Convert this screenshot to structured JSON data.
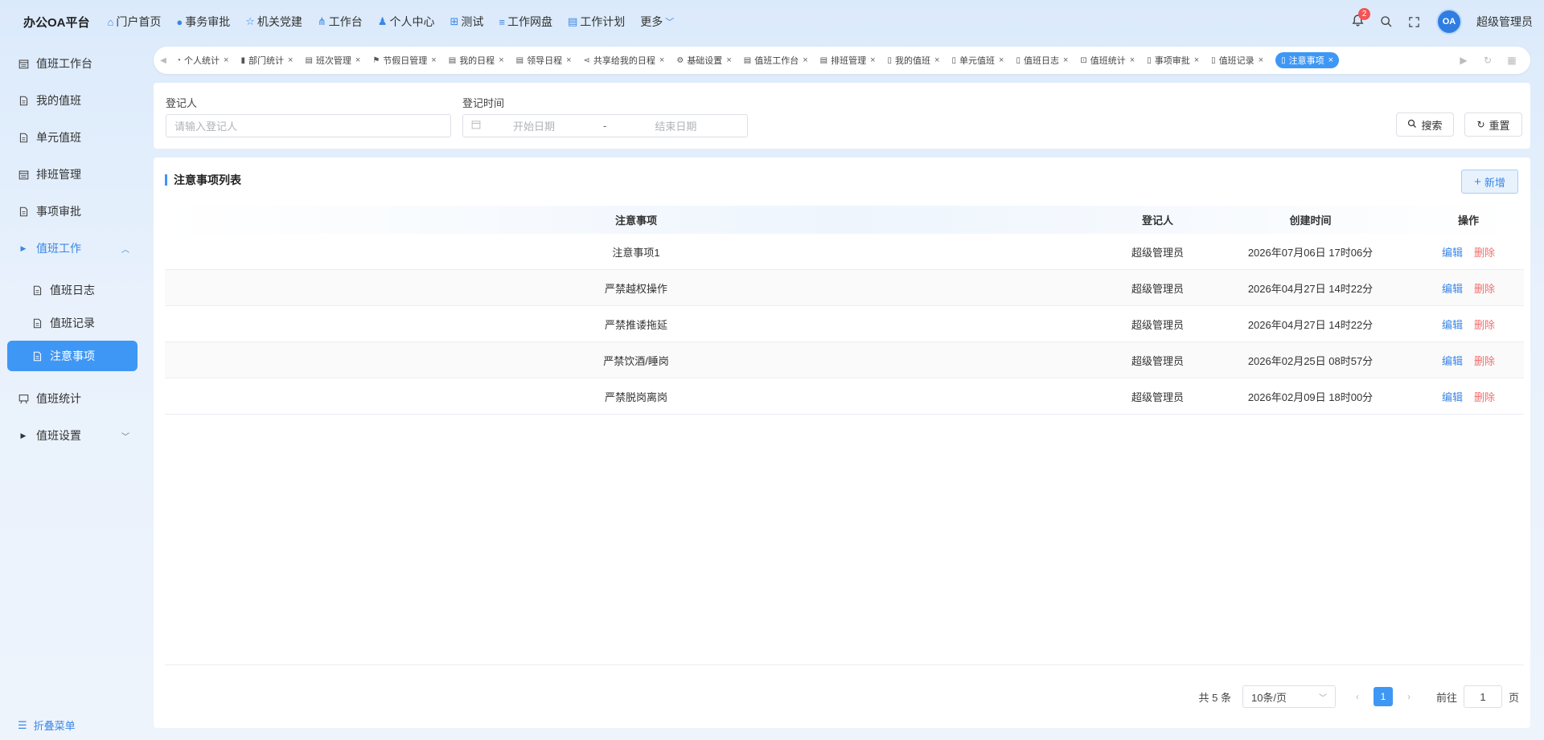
{
  "app": {
    "title": "办公OA平台"
  },
  "nav": [
    {
      "icon": "home-icon",
      "glyph": "⌂",
      "label": "门户首页"
    },
    {
      "icon": "approval-icon",
      "glyph": "●",
      "label": "事务审批"
    },
    {
      "icon": "star-icon",
      "glyph": "☆",
      "label": "机关党建"
    },
    {
      "icon": "workbench-icon",
      "glyph": "⋔",
      "label": "工作台"
    },
    {
      "icon": "user-icon",
      "glyph": "♟",
      "label": "个人中心"
    },
    {
      "icon": "grid-icon",
      "glyph": "⊞",
      "label": "测试"
    },
    {
      "icon": "database-icon",
      "glyph": "≡",
      "label": "工作网盘"
    },
    {
      "icon": "calendar-icon",
      "glyph": "▤",
      "label": "工作计划"
    }
  ],
  "nav_more": "更多",
  "header": {
    "badge_count": "2",
    "avatar_text": "OA",
    "username": "超级管理员"
  },
  "sidebar": {
    "items": [
      {
        "label": "值班工作台",
        "icon": "calendar-icon"
      },
      {
        "label": "我的值班",
        "icon": "document-icon"
      },
      {
        "label": "单元值班",
        "icon": "document-icon"
      },
      {
        "label": "排班管理",
        "icon": "calendar-icon"
      },
      {
        "label": "事项审批",
        "icon": "document-icon"
      },
      {
        "label": "值班工作",
        "icon": "caret-right-icon"
      },
      {
        "label": "值班日志",
        "icon": "document-icon"
      },
      {
        "label": "值班记录",
        "icon": "document-icon"
      },
      {
        "label": "注意事项",
        "icon": "document-icon"
      },
      {
        "label": "值班统计",
        "icon": "board-icon"
      },
      {
        "label": "值班设置",
        "icon": "caret-right-icon"
      }
    ],
    "collapse_label": "折叠菜单"
  },
  "tabs": [
    {
      "label": "个人统计",
      "icon": "pie-icon"
    },
    {
      "label": "部门统计",
      "icon": "bar-icon"
    },
    {
      "label": "班次管理",
      "icon": "calendar-icon"
    },
    {
      "label": "节假日管理",
      "icon": "flag-icon"
    },
    {
      "label": "我的日程",
      "icon": "calendar-icon"
    },
    {
      "label": "领导日程",
      "icon": "calendar-icon"
    },
    {
      "label": "共享给我的日程",
      "icon": "share-icon"
    },
    {
      "label": "基础设置",
      "icon": "gear-icon"
    },
    {
      "label": "值班工作台",
      "icon": "calendar-icon"
    },
    {
      "label": "排班管理",
      "icon": "calendar-icon"
    },
    {
      "label": "我的值班",
      "icon": "document-icon"
    },
    {
      "label": "单元值班",
      "icon": "document-icon"
    },
    {
      "label": "值班日志",
      "icon": "document-icon"
    },
    {
      "label": "值班统计",
      "icon": "board-icon"
    },
    {
      "label": "事项审批",
      "icon": "document-icon"
    },
    {
      "label": "值班记录",
      "icon": "document-icon"
    },
    {
      "label": "注意事项",
      "icon": "document-icon"
    }
  ],
  "filter": {
    "registrant_label": "登记人",
    "registrant_placeholder": "请输入登记人",
    "time_label": "登记时间",
    "start_placeholder": "开始日期",
    "range_sep": "-",
    "end_placeholder": "结束日期",
    "search_label": "搜索",
    "reset_label": "重置"
  },
  "list": {
    "title": "注意事项列表",
    "add_label": "新增",
    "columns": [
      "注意事项",
      "登记人",
      "创建时间",
      "操作"
    ],
    "rows": [
      {
        "item": "注意事项1",
        "registrant": "超级管理员",
        "created": "2026年07月06日 17时06分"
      },
      {
        "item": "严禁越权操作",
        "registrant": "超级管理员",
        "created": "2026年04月27日 14时22分"
      },
      {
        "item": "严禁推诿拖延",
        "registrant": "超级管理员",
        "created": "2026年04月27日 14时22分"
      },
      {
        "item": "严禁饮酒/睡岗",
        "registrant": "超级管理员",
        "created": "2026年02月25日 08时57分"
      },
      {
        "item": "严禁脱岗离岗",
        "registrant": "超级管理员",
        "created": "2026年02月09日 18时00分"
      }
    ],
    "edit_label": "编辑",
    "delete_label": "删除"
  },
  "pagination": {
    "total": "共 5 条",
    "page_size": "10条/页",
    "current_page": "1",
    "goto_label": "前往",
    "goto_value": "1",
    "page_suffix": "页"
  },
  "colors": {
    "accent": "#3e97f5",
    "danger": "#f56c6c",
    "badge": "#f35454"
  }
}
